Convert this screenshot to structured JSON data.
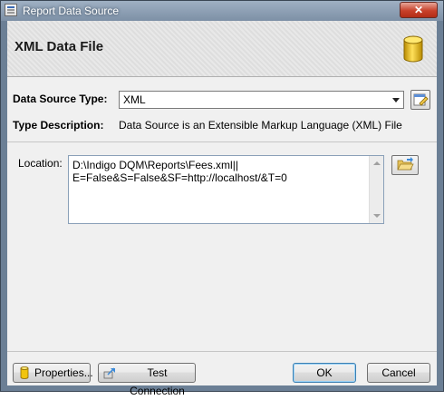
{
  "window": {
    "title": "Report Data Source",
    "close_glyph": "✕"
  },
  "header": {
    "title": "XML Data File",
    "icon": "database-icon"
  },
  "form": {
    "data_source_type_label": "Data Source Type:",
    "data_source_type_value": "XML",
    "type_description_label": "Type Description:",
    "type_description_value": "Data Source is an Extensible Markup Language (XML) File",
    "location_label": "Location:",
    "location_lines": [
      "D:\\Indigo DQM\\Reports\\Fees.xml||",
      "E=False&S=False&SF=http://localhost/&T=0"
    ]
  },
  "footer": {
    "properties_label": "Properties...",
    "test_connection_label": "Test Connection",
    "ok_label": "OK",
    "cancel_label": "Cancel"
  },
  "colors": {
    "accent": "#3c7fb1",
    "close": "#c8412a",
    "database": "#e8b800"
  }
}
